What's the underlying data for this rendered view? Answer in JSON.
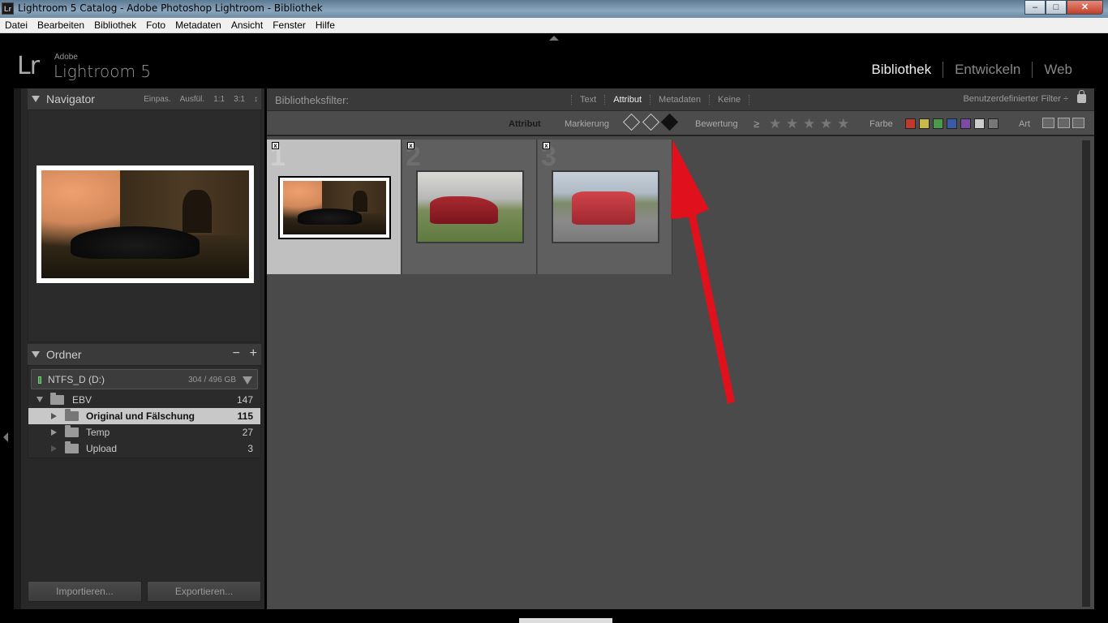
{
  "window": {
    "title": "Lightroom 5 Catalog - Adobe Photoshop Lightroom - Bibliothek",
    "app_icon": "Lr"
  },
  "menu": [
    "Datei",
    "Bearbeiten",
    "Bibliothek",
    "Foto",
    "Metadaten",
    "Ansicht",
    "Fenster",
    "Hilfe"
  ],
  "logo": {
    "mark": "Lr",
    "adobe": "Adobe",
    "product": "Lightroom 5"
  },
  "modules": [
    "Bibliothek",
    "Entwickeln",
    "Web"
  ],
  "navigator": {
    "title": "Navigator",
    "options": [
      "Einpas.",
      "Ausfül.",
      "1:1",
      "3:1"
    ]
  },
  "ordner": {
    "title": "Ordner",
    "minus": "−",
    "plus": "+",
    "volume": {
      "name": "NTFS_D (D:)",
      "size": "304 / 496 GB"
    },
    "folders": [
      {
        "label": "EBV",
        "count": "147"
      },
      {
        "label": "Original und Fälschung",
        "count": "115"
      },
      {
        "label": "Temp",
        "count": "27"
      },
      {
        "label": "Upload",
        "count": "3"
      }
    ]
  },
  "buttons": {
    "import": "Importieren...",
    "export": "Exportieren..."
  },
  "filter": {
    "label": "Bibliotheksfilter:",
    "tabs": [
      "Text",
      "Attribut",
      "Metadaten",
      "Keine"
    ],
    "custom": "Benutzerdefinierter Filter ÷"
  },
  "attr": {
    "attribut": "Attribut",
    "markierung": "Markierung",
    "bewertung": "Bewertung",
    "gte": "≥",
    "star": "★",
    "farbe": "Farbe",
    "art": "Art",
    "colors": [
      "#c0392b",
      "#c9b84a",
      "#4c9a4c",
      "#3b5aa6",
      "#7a4ca6",
      "#cccccc",
      "#777777"
    ]
  },
  "grid": [
    {
      "num": "1",
      "reject": "x"
    },
    {
      "num": "2",
      "reject": "x"
    },
    {
      "num": "3",
      "reject": "x"
    }
  ],
  "annotation_color": "#e0101c"
}
